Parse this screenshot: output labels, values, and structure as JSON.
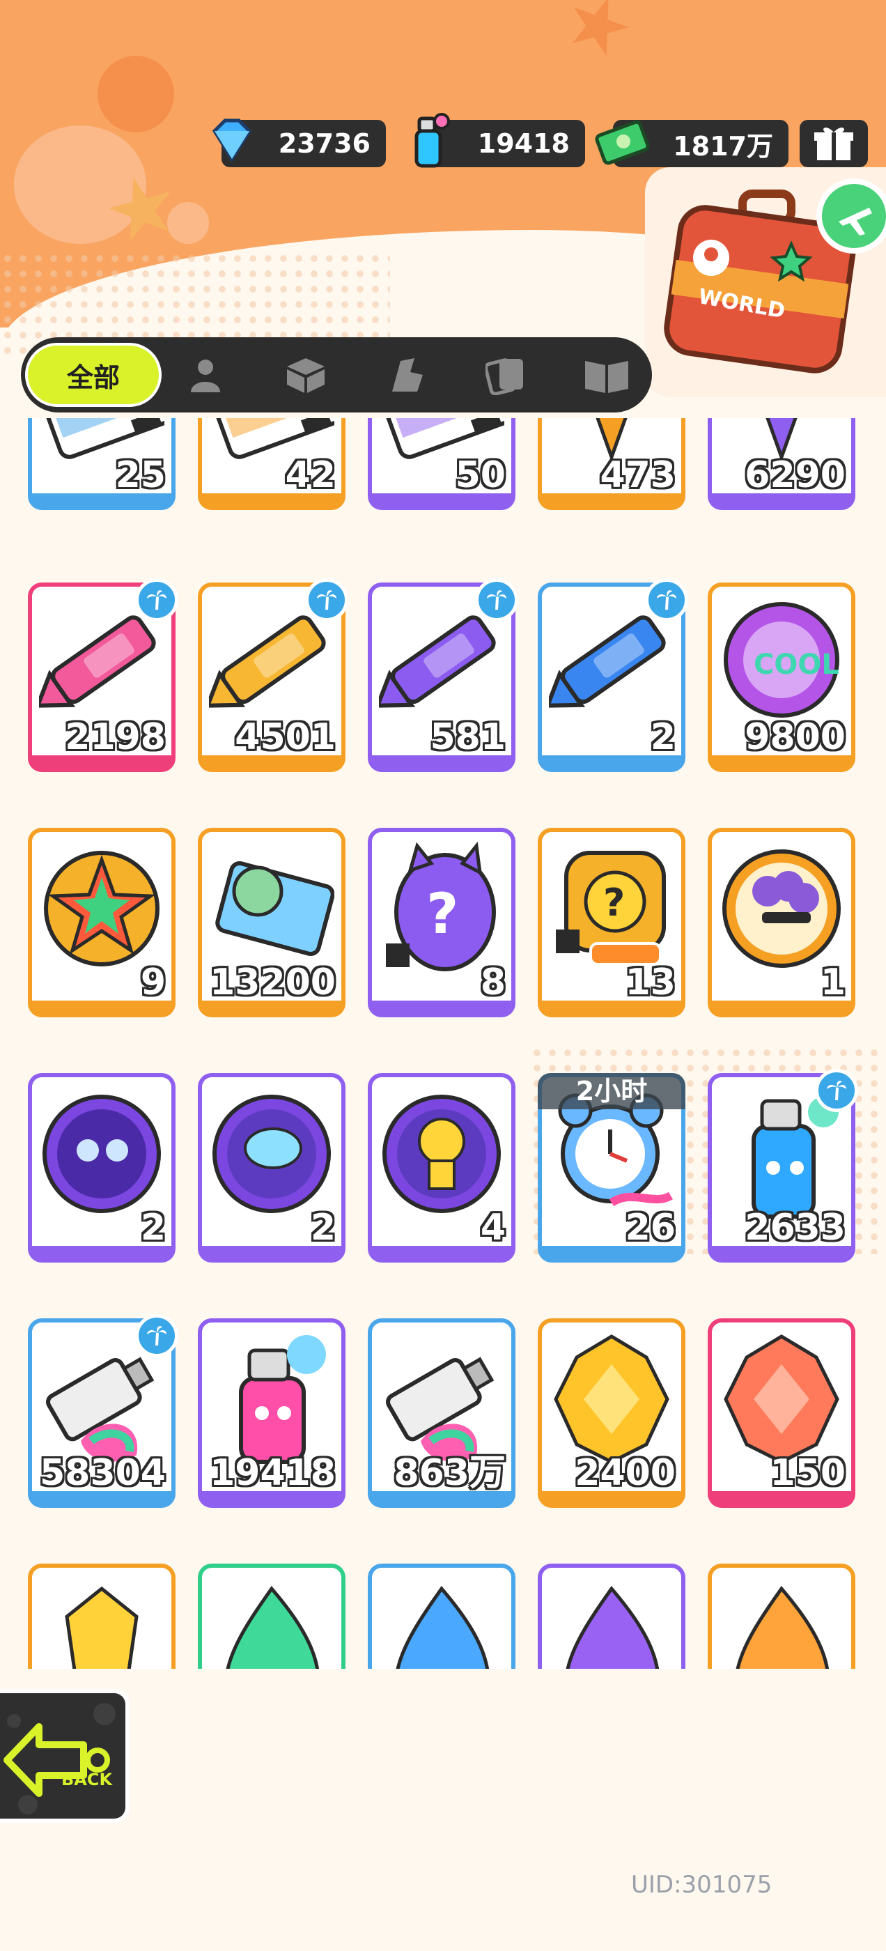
{
  "currencies": {
    "diamonds": "23736",
    "spray": "19418",
    "cash": "1817万"
  },
  "tabs": {
    "all": "全部",
    "icons": [
      "person-icon",
      "box-icon",
      "sneaker-icon",
      "cards-icon",
      "book-icon"
    ]
  },
  "world_button": {
    "label": "WORLD"
  },
  "items": [
    {
      "qty": "25",
      "color": "#4aa6ea",
      "art": "ticket"
    },
    {
      "qty": "42",
      "color": "#f5a024",
      "art": "ticket"
    },
    {
      "qty": "50",
      "color": "#8f5ff0",
      "art": "ticket"
    },
    {
      "qty": "473",
      "color": "#f5a024",
      "art": "crystal-star"
    },
    {
      "qty": "6290",
      "color": "#8f5ff0",
      "art": "crystal-star"
    },
    {
      "qty": "2198",
      "color": "#ef3f7a",
      "art": "crayon",
      "badge": true,
      "tint": "#f25a9b"
    },
    {
      "qty": "4501",
      "color": "#f5a024",
      "art": "crayon",
      "badge": true,
      "tint": "#f7b733"
    },
    {
      "qty": "581",
      "color": "#8f5ff0",
      "art": "crayon",
      "badge": true,
      "tint": "#8c5cf0"
    },
    {
      "qty": "2",
      "color": "#4aa6ea",
      "art": "crayon",
      "badge": true,
      "tint": "#3a86f0"
    },
    {
      "qty": "9800",
      "color": "#f5a024",
      "art": "cool-badge"
    },
    {
      "qty": "9",
      "color": "#f5a024",
      "art": "star-badge"
    },
    {
      "qty": "13200",
      "color": "#f5a024",
      "art": "season-card"
    },
    {
      "qty": "8",
      "color": "#8f5ff0",
      "art": "mystery-egg"
    },
    {
      "qty": "13",
      "color": "#f5a024",
      "art": "mystery-dotty"
    },
    {
      "qty": "1",
      "color": "#f5a024",
      "art": "coin-grape"
    },
    {
      "qty": "2",
      "color": "#8f5ff0",
      "art": "coin-purple"
    },
    {
      "qty": "2",
      "color": "#8f5ff0",
      "art": "coin-fish"
    },
    {
      "qty": "4",
      "color": "#8f5ff0",
      "art": "coin-yellow"
    },
    {
      "qty": "26",
      "color": "#4aa6ea",
      "art": "alarm",
      "timer": "2小时"
    },
    {
      "qty": "2633",
      "color": "#8f5ff0",
      "art": "spray-blue",
      "badge": true
    },
    {
      "qty": "58304",
      "color": "#4aa6ea",
      "art": "paint-tube",
      "badge": true
    },
    {
      "qty": "19418",
      "color": "#8f5ff0",
      "art": "spray-pink"
    },
    {
      "qty": "863万",
      "color": "#4aa6ea",
      "art": "paint-tube"
    },
    {
      "qty": "2400",
      "color": "#f5a024",
      "art": "gem-gold"
    },
    {
      "qty": "150",
      "color": "#ef3f7a",
      "art": "gem-red"
    },
    {
      "qty": "",
      "color": "#f5a024",
      "art": "crystal-yellow"
    },
    {
      "qty": "",
      "color": "#2fcf8a",
      "art": "flame-green"
    },
    {
      "qty": "",
      "color": "#4aa6ea",
      "art": "flame-blue"
    },
    {
      "qty": "",
      "color": "#8f5ff0",
      "art": "flame-purple"
    },
    {
      "qty": "",
      "color": "#f5a024",
      "art": "flame-orange"
    }
  ],
  "back_button": {
    "label": "BACK"
  },
  "uid": "UID:301075"
}
